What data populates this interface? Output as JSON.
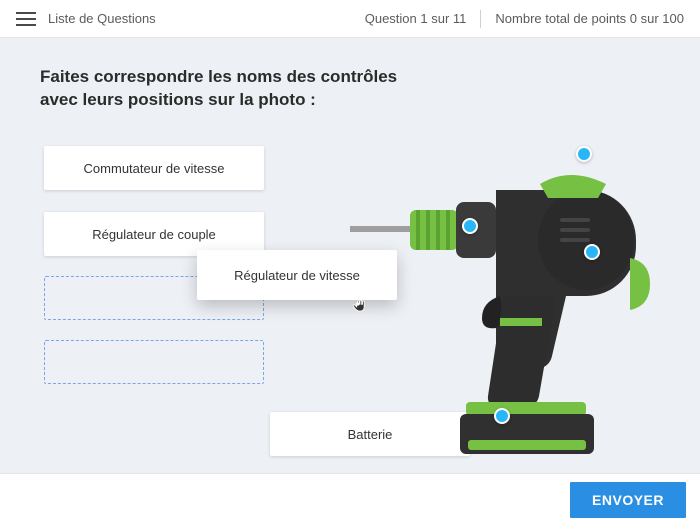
{
  "topbar": {
    "title": "Liste de Questions",
    "progress": "Question 1 sur 11",
    "points": "Nombre total de points 0 sur 100"
  },
  "prompt": {
    "line1": "Faites correspondre les noms des contrôles",
    "line2": "avec leurs positions sur la photo :"
  },
  "cards": {
    "speed_switch": "Commutateur de vitesse",
    "torque_regulator": "Régulateur de couple",
    "speed_regulator": "Régulateur de vitesse",
    "battery": "Batterie"
  },
  "hotspots": {
    "names": [
      "hotspot-top",
      "hotspot-chuck",
      "hotspot-handle",
      "hotspot-battery"
    ]
  },
  "footer": {
    "submit": "ENVOYER"
  }
}
